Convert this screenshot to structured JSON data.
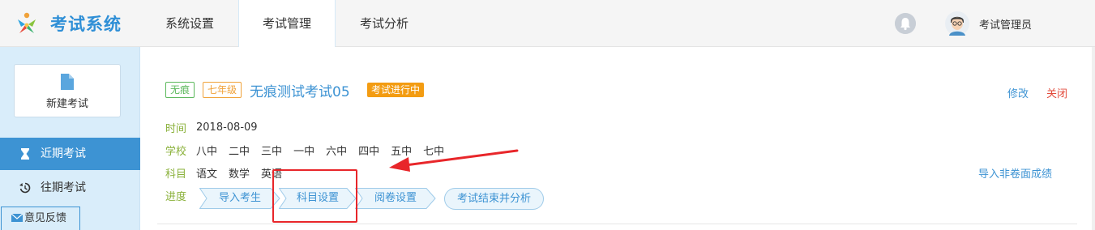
{
  "app": {
    "title": "考试系统",
    "user_name": "考试管理员"
  },
  "nav": {
    "items": [
      {
        "label": "系统设置",
        "active": false
      },
      {
        "label": "考试管理",
        "active": true
      },
      {
        "label": "考试分析",
        "active": false
      }
    ]
  },
  "sidebar": {
    "new_exam_label": "新建考试",
    "items": [
      {
        "label": "近期考试",
        "icon": "hourglass-icon",
        "active": true
      },
      {
        "label": "往期考试",
        "icon": "history-icon",
        "active": false
      }
    ],
    "feedback_label": "意见反馈"
  },
  "exam": {
    "tag_trace": "无痕",
    "tag_grade": "七年级",
    "title": "无痕测试考试05",
    "status": "考试进行中",
    "edit_label": "修改",
    "close_label": "关闭",
    "time_label": "时间",
    "time_value": "2018-08-09",
    "school_label": "学校",
    "schools": [
      "八中",
      "二中",
      "三中",
      "一中",
      "六中",
      "四中",
      "五中",
      "七中"
    ],
    "subject_label": "科目",
    "subjects": [
      "语文",
      "数学",
      "英语"
    ],
    "import_label": "导入非卷面成绩",
    "progress_label": "进度",
    "steps": [
      "导入考生",
      "科目设置",
      "阅卷设置"
    ],
    "final_step": "考试结束并分析"
  },
  "colors": {
    "brand": "#2f8fd6",
    "accent": "#3d93d3",
    "green": "#8ab13a",
    "status": "#f39c12",
    "danger": "#e24a3b",
    "annotation": "#e8262a"
  }
}
